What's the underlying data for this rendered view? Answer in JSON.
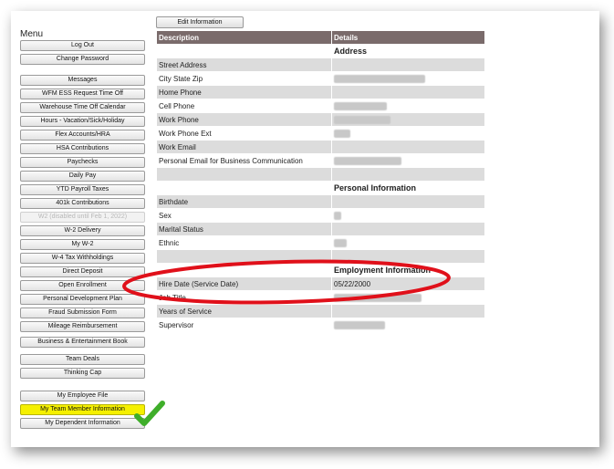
{
  "menu": {
    "title": "Menu",
    "group1": [
      "Log Out",
      "Change Password"
    ],
    "group2": [
      "Messages",
      "WFM ESS Request Time Off",
      "Warehouse Time Off Calendar",
      "Hours - Vacation/Sick/Holiday",
      "Flex Accounts/HRA",
      "HSA Contributions",
      "Paychecks",
      "Daily Pay",
      "YTD Payroll Taxes",
      "401k Contributions",
      "W2 (disabled until Feb 1, 2022)",
      "W-2 Delivery",
      "My W-2",
      "W-4 Tax Withholdings",
      "Direct Deposit",
      "Open Enrollment",
      "Personal Development Plan",
      "Fraud Submission Form",
      "Mileage Reimbursement"
    ],
    "group3": [
      "Business & Entertainment Book"
    ],
    "group4": [
      "Team Deals",
      "Thinking Cap"
    ],
    "group5": [
      "My Employee File",
      "My Team Member Information",
      "My Dependent Information"
    ]
  },
  "edit_button": "Edit Information",
  "table": {
    "headers": [
      "Description",
      "Details"
    ],
    "address_section": "Address",
    "address_rows": [
      "Street Address",
      "City State Zip",
      "Home Phone",
      "Cell Phone",
      "Work Phone",
      "Work Phone Ext",
      "Work Email",
      "Personal Email for Business Communication"
    ],
    "personal_section": "Personal Information",
    "personal_rows": [
      "Birthdate",
      "Sex",
      "Marital Status",
      "Ethnic"
    ],
    "employment_section": "Employment Information",
    "hire_date_label": "Hire Date (Service Date)",
    "hire_date_value": "05/22/2000",
    "employment_rows": [
      "Job Title",
      "Years of Service",
      "Supervisor"
    ]
  },
  "colors": {
    "header_bg": "#7a6b6b",
    "row_shade": "#dcdcdc",
    "highlight": "#f5f000",
    "annotation_ellipse": "#e0101a",
    "checkmark": "#3fae2a"
  }
}
